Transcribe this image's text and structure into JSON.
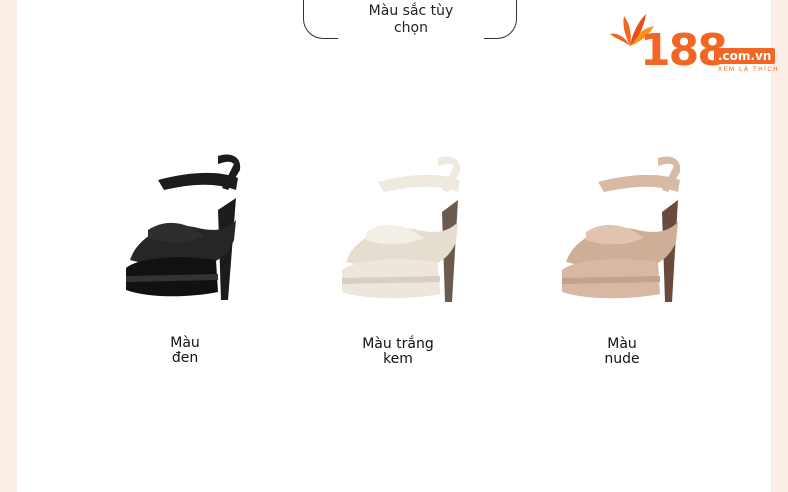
{
  "header": {
    "title_line1": "Màu sắc tùy",
    "title_line2": "chọn"
  },
  "logo": {
    "number": "188",
    "domain": ".com.vn",
    "tagline": "XEM LÀ THÍCH",
    "icon": "flower-icon",
    "accent_color": "#f26522"
  },
  "products": [
    {
      "line1": "Màu",
      "line2": "đen",
      "color": "#1c1c1c"
    },
    {
      "line1": "Màu trắng",
      "line2": "kem",
      "color": "#ece6dc"
    },
    {
      "line1": "Màu",
      "line2": "nude",
      "color": "#d8b9a3"
    }
  ]
}
